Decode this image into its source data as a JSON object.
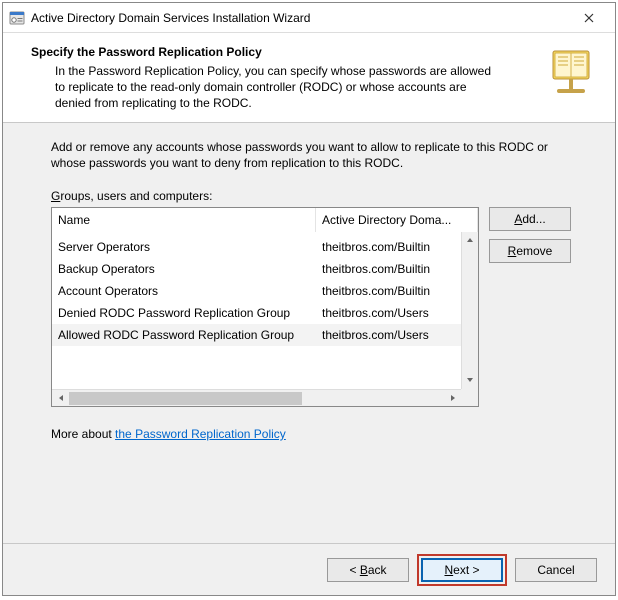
{
  "titlebar": {
    "title": "Active Directory Domain Services Installation Wizard"
  },
  "header": {
    "heading": "Specify the Password Replication Policy",
    "description": "In the Password Replication Policy, you can specify whose passwords are allowed to replicate to the read-only domain controller (RODC) or whose accounts are denied from replicating to the RODC."
  },
  "body": {
    "instruction": "Add or remove any accounts whose passwords you want to allow to replicate to this RODC or whose passwords you want to deny from replication to this RODC.",
    "list_label_pre": "G",
    "list_label_rest": "roups, users and computers:",
    "columns": {
      "name": "Name",
      "folder": "Active Directory Doma..."
    },
    "rows": [
      {
        "name": "Server Operators",
        "folder": "theitbros.com/Builtin"
      },
      {
        "name": "Backup Operators",
        "folder": "theitbros.com/Builtin"
      },
      {
        "name": "Account Operators",
        "folder": "theitbros.com/Builtin"
      },
      {
        "name": "Denied RODC Password Replication Group",
        "folder": "theitbros.com/Users"
      },
      {
        "name": "Allowed RODC Password Replication Group",
        "folder": "theitbros.com/Users"
      }
    ],
    "buttons": {
      "add_pre": "A",
      "add_rest": "dd...",
      "remove_pre": "R",
      "remove_rest": "emove"
    },
    "more_prefix": "More about ",
    "more_link": "the Password Replication Policy"
  },
  "footer": {
    "back_pre": "< ",
    "back_u": "B",
    "back_rest": "ack",
    "next_u": "N",
    "next_rest": "ext >",
    "cancel": "Cancel"
  }
}
